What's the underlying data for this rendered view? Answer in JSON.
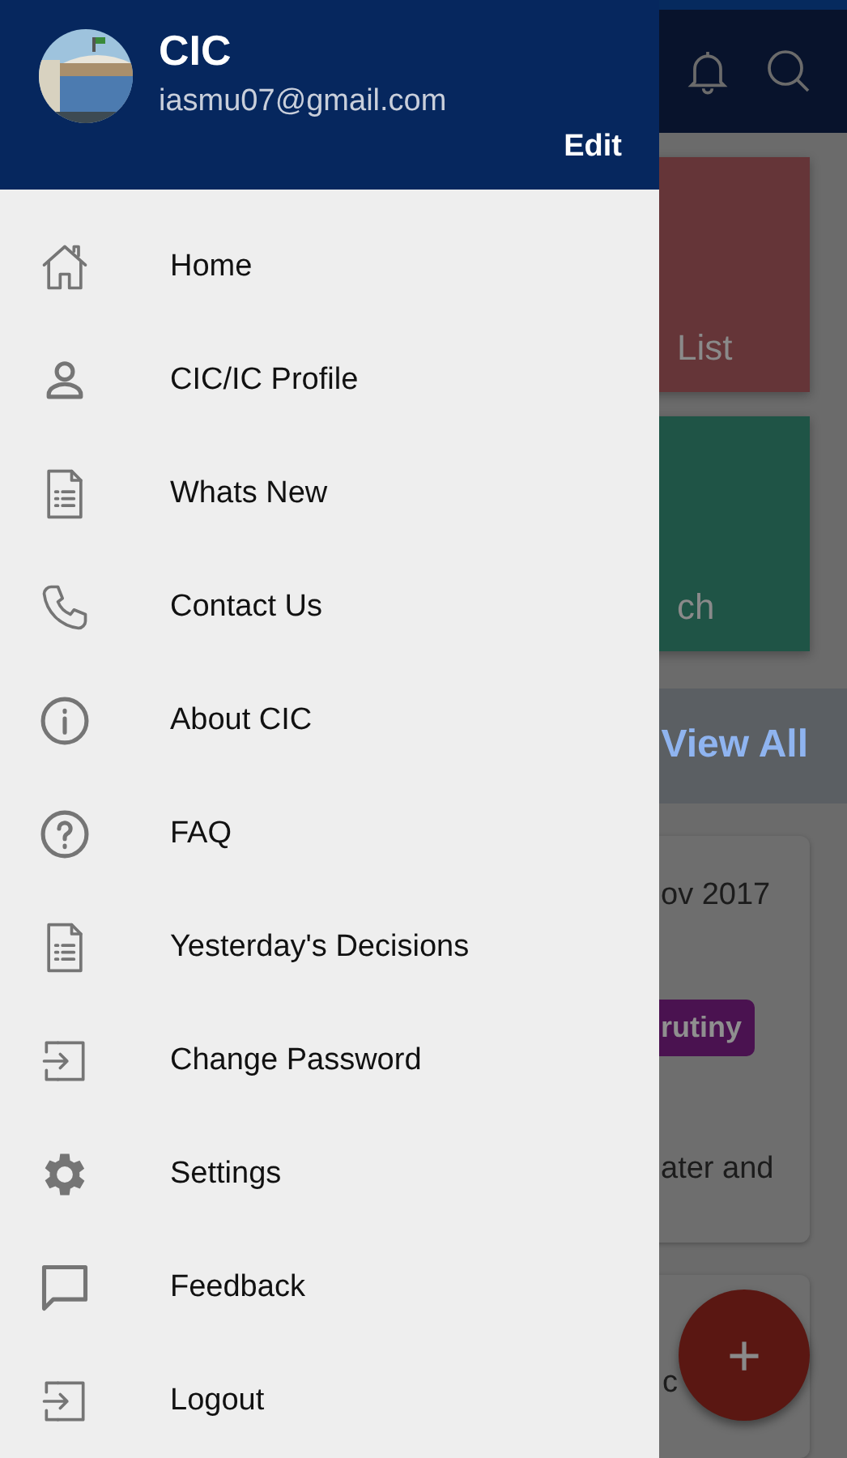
{
  "drawer": {
    "header": {
      "name": "CIC",
      "email": "iasmu07@gmail.com",
      "edit": "Edit"
    },
    "items": [
      {
        "label": "Home"
      },
      {
        "label": "CIC/IC Profile"
      },
      {
        "label": "Whats New"
      },
      {
        "label": "Contact Us"
      },
      {
        "label": "About CIC"
      },
      {
        "label": "FAQ"
      },
      {
        "label": "Yesterday's Decisions"
      },
      {
        "label": "Change Password"
      },
      {
        "label": "Settings"
      },
      {
        "label": "Feedback"
      },
      {
        "label": "Logout"
      }
    ]
  },
  "background": {
    "tiles": [
      {
        "label": "List",
        "color": "#653538"
      },
      {
        "label": "ch",
        "color": "#1f5446"
      }
    ],
    "view_all": "View All",
    "card": {
      "date": "ov 2017",
      "tag": "rutiny",
      "text": "ater and"
    },
    "card_2": {
      "text": "c"
    },
    "fab": "+"
  }
}
